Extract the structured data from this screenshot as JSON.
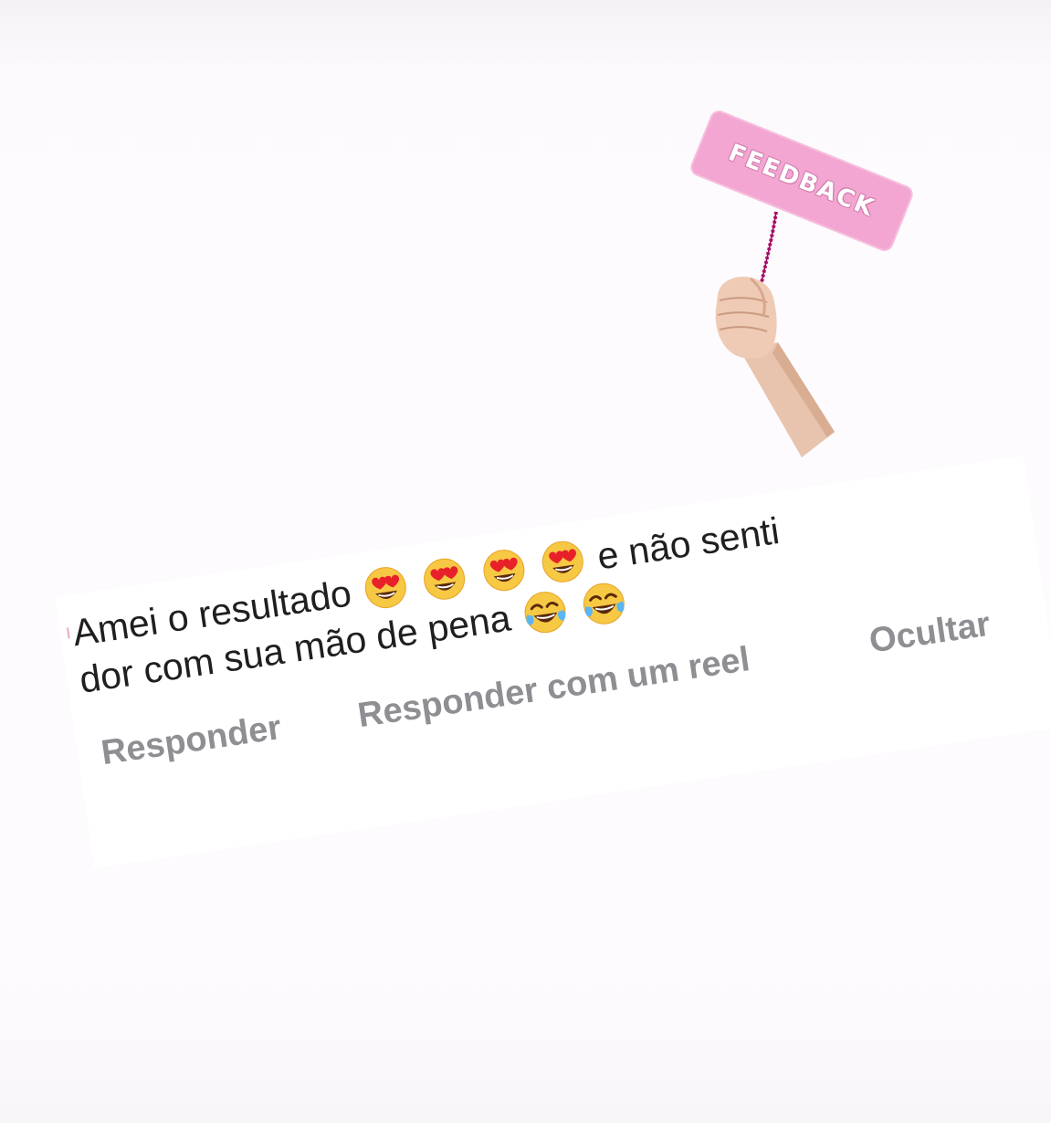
{
  "sticker": {
    "sign_text": "FEEDBACK",
    "sign_color": "#f2a6d1",
    "stick_color": "#c2187a",
    "icon": "hand-holding-sign-icon"
  },
  "comment": {
    "text_line1_start": "Amei o resultado",
    "text_line1_end": "e não senti",
    "text_line2": "dor com sua mão de pena",
    "emojis_line1": [
      "heart-eyes-emoji",
      "heart-eyes-emoji",
      "heart-eyes-emoji",
      "heart-eyes-emoji"
    ],
    "emojis_line2": [
      "tears-of-joy-emoji",
      "tears-of-joy-emoji"
    ]
  },
  "actions": {
    "reply": "Responder",
    "reply_reel": "Responder com um reel",
    "hide": "Ocultar"
  },
  "colors": {
    "text": "#1f1f1f",
    "action_text": "#8e8e93",
    "accent_pink": "#e9a7c6"
  }
}
